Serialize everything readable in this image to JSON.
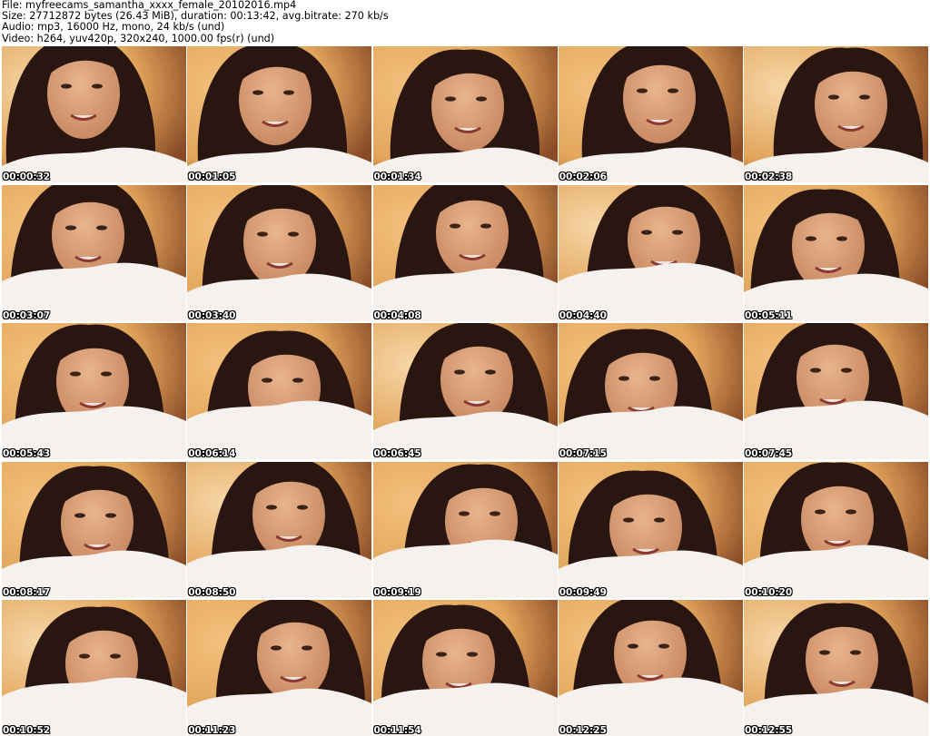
{
  "header": {
    "file": "File: myfreecams_samantha_xxxx_female_20102016.mp4",
    "size": "Size: 27712872 bytes (26.43 MiB), duration: 00:13:42, avg.bitrate: 270 kb/s",
    "audio": "Audio: mp3, 16000 Hz, mono, 24 kb/s (und)",
    "video": "Video: h264, yuv420p, 320x240, 1000.00 fps(r) (und)"
  },
  "frames": [
    {
      "timestamp": "00:00:32"
    },
    {
      "timestamp": "00:01:05"
    },
    {
      "timestamp": "00:01:34"
    },
    {
      "timestamp": "00:02:06"
    },
    {
      "timestamp": "00:02:38"
    },
    {
      "timestamp": "00:03:07"
    },
    {
      "timestamp": "00:03:40"
    },
    {
      "timestamp": "00:04:08"
    },
    {
      "timestamp": "00:04:40"
    },
    {
      "timestamp": "00:05:11"
    },
    {
      "timestamp": "00:05:43"
    },
    {
      "timestamp": "00:06:14"
    },
    {
      "timestamp": "00:06:45"
    },
    {
      "timestamp": "00:07:15"
    },
    {
      "timestamp": "00:07:45"
    },
    {
      "timestamp": "00:08:17"
    },
    {
      "timestamp": "00:08:50"
    },
    {
      "timestamp": "00:09:19"
    },
    {
      "timestamp": "00:09:49"
    },
    {
      "timestamp": "00:10:20"
    },
    {
      "timestamp": "00:10:52"
    },
    {
      "timestamp": "00:11:23"
    },
    {
      "timestamp": "00:11:54"
    },
    {
      "timestamp": "00:12:25"
    },
    {
      "timestamp": "00:12:55"
    }
  ],
  "colors": {
    "header_text": "#000000",
    "timestamp_text": "#ffffff",
    "timestamp_outline": "#000000",
    "hair": "#2a1610",
    "skin": "#c98a62",
    "pillow": "#f4f1ee",
    "background_warm": "#e2a55c"
  }
}
